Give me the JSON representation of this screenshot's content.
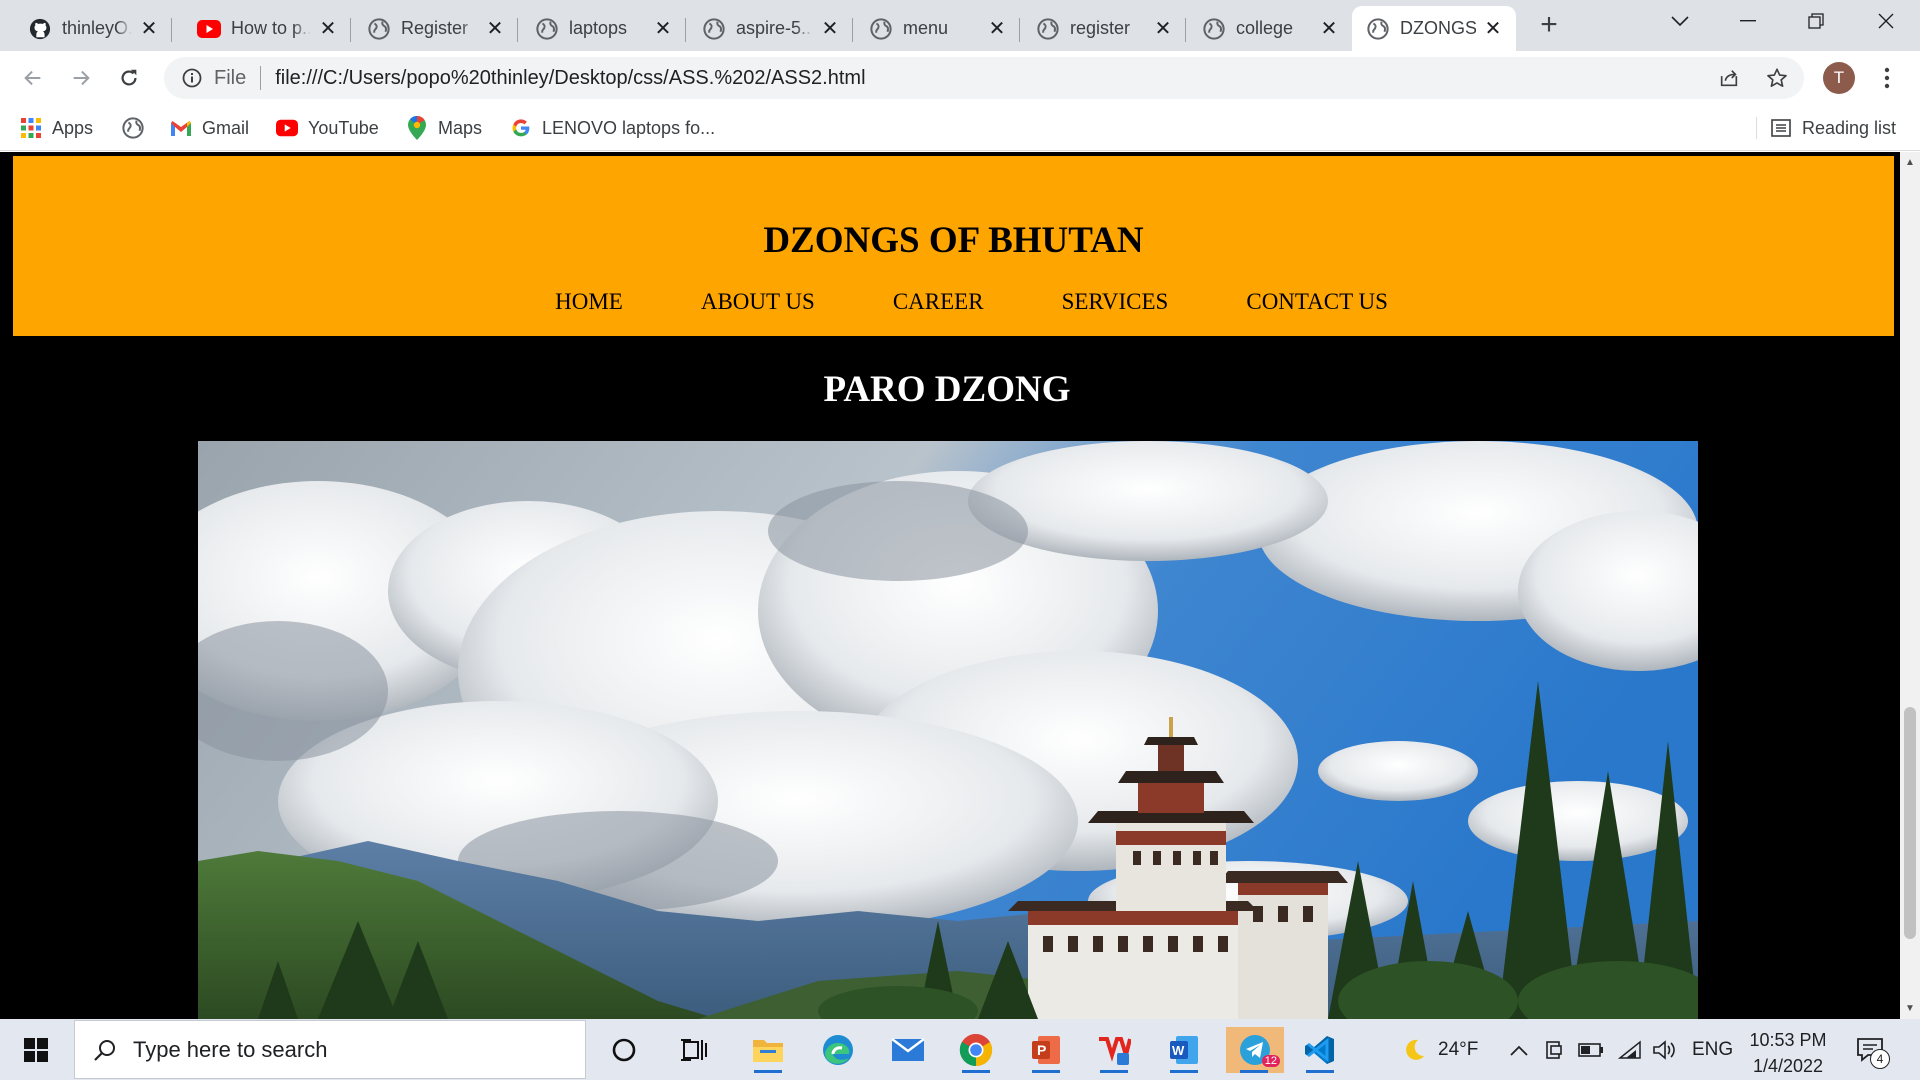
{
  "browser": {
    "tabs": [
      {
        "title": "thinleyO..",
        "icon": "github-icon",
        "active": false
      },
      {
        "title": "How to p..",
        "icon": "youtube-icon",
        "active": false
      },
      {
        "title": "Register",
        "icon": "globe-icon",
        "active": false
      },
      {
        "title": "laptops",
        "icon": "globe-icon",
        "active": false
      },
      {
        "title": "aspire-5..",
        "icon": "globe-icon",
        "active": false
      },
      {
        "title": "menu",
        "icon": "globe-icon",
        "active": false
      },
      {
        "title": "register",
        "icon": "globe-icon",
        "active": false
      },
      {
        "title": "college",
        "icon": "globe-icon",
        "active": false
      },
      {
        "title": "DZONGS",
        "icon": "globe-icon",
        "active": true
      }
    ],
    "address": {
      "scheme_label": "File",
      "url": "file:///C:/Users/popo%20thinley/Desktop/css/ASS.%202/ASS2.html"
    },
    "profile_initial": "T",
    "bookmarks": [
      {
        "label": "Apps",
        "icon": "apps-grid-icon"
      },
      {
        "label": "",
        "icon": "globe-icon"
      },
      {
        "label": "Gmail",
        "icon": "gmail-icon"
      },
      {
        "label": "YouTube",
        "icon": "youtube-icon"
      },
      {
        "label": "Maps",
        "icon": "maps-pin-icon"
      },
      {
        "label": "LENOVO laptops fo...",
        "icon": "google-icon"
      }
    ],
    "reading_list": "Reading list"
  },
  "page": {
    "site_title": "DZONGS OF BHUTAN",
    "nav": [
      "HOME",
      "ABOUT US",
      "CAREER",
      "SERVICES",
      "CONTACT US"
    ],
    "section_heading": "PARO DZONG",
    "colors": {
      "header_bg": "#ffa500",
      "page_bg": "#000000",
      "heading_text": "#ffffff"
    }
  },
  "taskbar": {
    "search_placeholder": "Type here to search",
    "weather": "24°F",
    "language": "ENG",
    "time": "10:53 PM",
    "date": "1/4/2022",
    "telegram_badge": "12",
    "notification_count": "4",
    "pinned_apps": [
      "cortana-circle-icon",
      "task-view-icon",
      "file-explorer-icon",
      "edge-icon",
      "mail-icon",
      "chrome-icon",
      "powerpoint-icon",
      "wps-icon",
      "word-icon",
      "telegram-icon",
      "vscode-icon"
    ]
  }
}
